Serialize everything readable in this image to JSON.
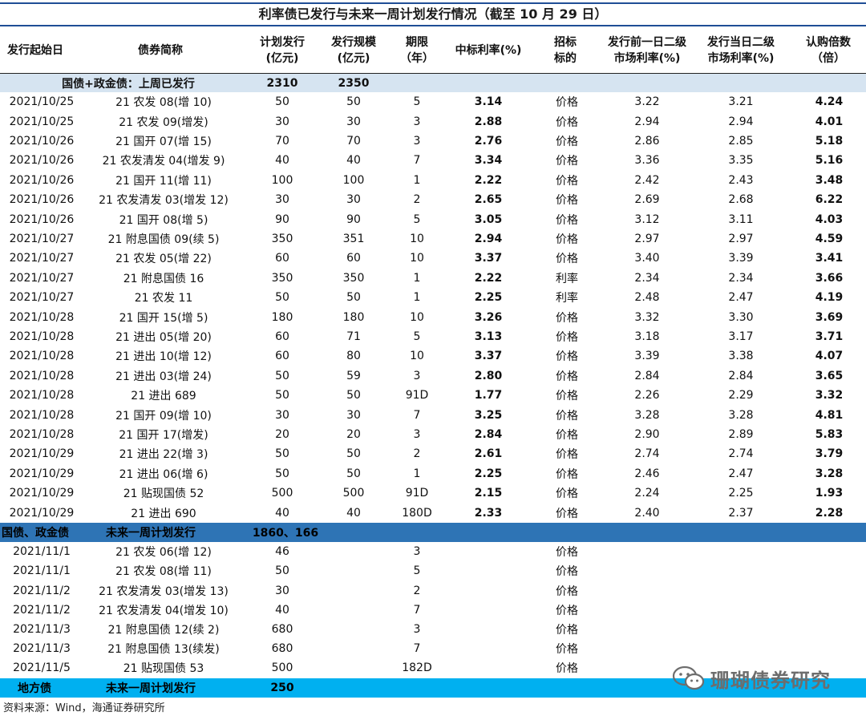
{
  "title": "利率债已发行与未来一周计划发行情况（截至 10 月 29 日）",
  "headers": {
    "date": "发行起始日",
    "name": "债券简称",
    "plan": [
      "计划发行",
      "(亿元)"
    ],
    "size": [
      "发行规模",
      "(亿元)"
    ],
    "term": [
      "期限",
      "（年）"
    ],
    "rate": "中标利率(%)",
    "target": [
      "招标",
      "标的"
    ],
    "pre": [
      "发行前一日二级",
      "市场利率(%)"
    ],
    "day": [
      "发行当日二级",
      "市场利率(%)"
    ],
    "mult": [
      "认购倍数",
      "（倍）"
    ]
  },
  "section1": {
    "label": "国债+政金债：上周已发行",
    "plan_total": "2310",
    "size_total": "2350"
  },
  "issued": [
    [
      "2021/10/25",
      "21 农发 08(增 10)",
      "50",
      "50",
      "5",
      "3.14",
      "价格",
      "3.22",
      "3.21",
      "4.24"
    ],
    [
      "2021/10/25",
      "21 农发 09(增发)",
      "30",
      "30",
      "3",
      "2.88",
      "价格",
      "2.94",
      "2.94",
      "4.01"
    ],
    [
      "2021/10/26",
      "21 国开 07(增 15)",
      "70",
      "70",
      "3",
      "2.76",
      "价格",
      "2.86",
      "2.85",
      "5.18"
    ],
    [
      "2021/10/26",
      "21 农发清发 04(增发 9)",
      "40",
      "40",
      "7",
      "3.34",
      "价格",
      "3.36",
      "3.35",
      "5.16"
    ],
    [
      "2021/10/26",
      "21 国开 11(增 11)",
      "100",
      "100",
      "1",
      "2.22",
      "价格",
      "2.42",
      "2.43",
      "3.48"
    ],
    [
      "2021/10/26",
      "21 农发清发 03(增发 12)",
      "30",
      "30",
      "2",
      "2.65",
      "价格",
      "2.69",
      "2.68",
      "6.22"
    ],
    [
      "2021/10/26",
      "21 国开 08(增 5)",
      "90",
      "90",
      "5",
      "3.05",
      "价格",
      "3.12",
      "3.11",
      "4.03"
    ],
    [
      "2021/10/27",
      "21 附息国债 09(续 5)",
      "350",
      "351",
      "10",
      "2.94",
      "价格",
      "2.97",
      "2.97",
      "4.59"
    ],
    [
      "2021/10/27",
      "21 农发 05(增 22)",
      "60",
      "60",
      "10",
      "3.37",
      "价格",
      "3.40",
      "3.39",
      "3.41"
    ],
    [
      "2021/10/27",
      "21 附息国债 16",
      "350",
      "350",
      "1",
      "2.22",
      "利率",
      "2.34",
      "2.34",
      "3.66"
    ],
    [
      "2021/10/27",
      "21 农发 11",
      "50",
      "50",
      "1",
      "2.25",
      "利率",
      "2.48",
      "2.47",
      "4.19"
    ],
    [
      "2021/10/28",
      "21 国开 15(增 5)",
      "180",
      "180",
      "10",
      "3.26",
      "价格",
      "3.32",
      "3.30",
      "3.69"
    ],
    [
      "2021/10/28",
      "21 进出 05(增 20)",
      "60",
      "71",
      "5",
      "3.13",
      "价格",
      "3.18",
      "3.17",
      "3.71"
    ],
    [
      "2021/10/28",
      "21 进出 10(增 12)",
      "60",
      "80",
      "10",
      "3.37",
      "价格",
      "3.39",
      "3.38",
      "4.07"
    ],
    [
      "2021/10/28",
      "21 进出 03(增 24)",
      "50",
      "59",
      "3",
      "2.80",
      "价格",
      "2.84",
      "2.84",
      "3.65"
    ],
    [
      "2021/10/28",
      "21 进出 689",
      "50",
      "50",
      "91D",
      "1.77",
      "价格",
      "2.26",
      "2.29",
      "3.32"
    ],
    [
      "2021/10/28",
      "21 国开 09(增 10)",
      "30",
      "30",
      "7",
      "3.25",
      "价格",
      "3.28",
      "3.28",
      "4.81"
    ],
    [
      "2021/10/28",
      "21 国开 17(增发)",
      "20",
      "20",
      "3",
      "2.84",
      "价格",
      "2.90",
      "2.89",
      "5.83"
    ],
    [
      "2021/10/29",
      "21 进出 22(增 3)",
      "50",
      "50",
      "2",
      "2.61",
      "价格",
      "2.74",
      "2.74",
      "3.79"
    ],
    [
      "2021/10/29",
      "21 进出 06(增 6)",
      "50",
      "50",
      "1",
      "2.25",
      "价格",
      "2.46",
      "2.47",
      "3.28"
    ],
    [
      "2021/10/29",
      "21 贴现国债 52",
      "500",
      "500",
      "91D",
      "2.15",
      "价格",
      "2.24",
      "2.25",
      "1.93"
    ],
    [
      "2021/10/29",
      "21 进出 690",
      "40",
      "40",
      "180D",
      "2.33",
      "价格",
      "2.40",
      "2.37",
      "2.28"
    ]
  ],
  "section2": {
    "label_a": "国债、政金债",
    "label_b": "未来一周计划发行",
    "total": "1860、166"
  },
  "planned": [
    [
      "2021/11/1",
      "21 农发 06(增 12)",
      "46",
      "3",
      "价格"
    ],
    [
      "2021/11/1",
      "21 农发 08(增 11)",
      "50",
      "5",
      "价格"
    ],
    [
      "2021/11/2",
      "21 农发清发 03(增发 13)",
      "30",
      "2",
      "价格"
    ],
    [
      "2021/11/2",
      "21 农发清发 04(增发 10)",
      "40",
      "7",
      "价格"
    ],
    [
      "2021/11/3",
      "21 附息国债 12(续 2)",
      "680",
      "3",
      "价格"
    ],
    [
      "2021/11/3",
      "21 附息国债 13(续发)",
      "680",
      "7",
      "价格"
    ],
    [
      "2021/11/5",
      "21 贴现国债 53",
      "500",
      "182D",
      "价格"
    ]
  ],
  "section3": {
    "label_a": "地方债",
    "label_b": "未来一周计划发行",
    "total": "250"
  },
  "watermark": "珊瑚债券研究",
  "watermark_icon": "wechat-icon",
  "source": "资料来源：Wind，海通证券研究所"
}
